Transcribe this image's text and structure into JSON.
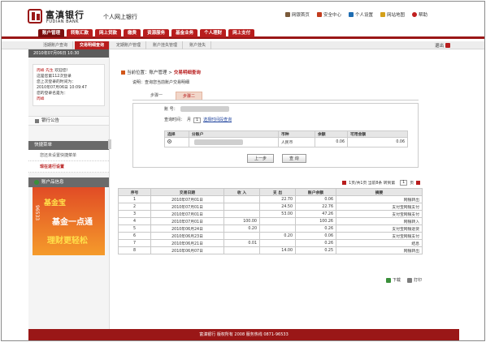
{
  "header": {
    "logo_cn": "富滇银行",
    "logo_en": "FUDIAN BANK",
    "subtitle": "个人网上银行",
    "links": [
      {
        "label": "网银首页",
        "icon": "home-icon",
        "color": "#7a5a3a"
      },
      {
        "label": "安全中心",
        "icon": "shield-icon",
        "color": "#c23c1e"
      },
      {
        "label": "个人设置",
        "icon": "user-icon",
        "color": "#1f6db2"
      },
      {
        "label": "网站地图",
        "icon": "sitemap-icon",
        "color": "#d4a019"
      },
      {
        "label": "帮助",
        "icon": "help-icon",
        "color": "#c01f1f"
      }
    ]
  },
  "nav": {
    "tabs": [
      "账户管理",
      "转账汇款",
      "网上贷款",
      "缴费",
      "资源服务",
      "基金业务",
      "个人理财",
      "网上支付"
    ],
    "active_index": 0
  },
  "subnav": {
    "items": [
      "活期账户查询",
      "交易明细查询",
      "定期账户管理",
      "账户挂失管理",
      "账户挂失"
    ],
    "active_index": 1,
    "logout": "退出"
  },
  "sidebar": {
    "date": "2010年07月06日 10:30",
    "welcome_name": "周峰 先生",
    "welcome_greeting": "欢迎您！",
    "welcome_text": [
      "这是您第112次登录",
      "您上次登录的时间为：",
      "2010年07月06日 10:09:47",
      "您的登录名是为：",
      "周峰"
    ],
    "notice": "银行公告",
    "quick_menu": "快捷菜单",
    "quick_links": [
      "您还未设置快捷菜单",
      "现在进行设置"
    ],
    "promo_head": "账户品信息",
    "promo": {
      "line1": "基金宝",
      "line2": "基金一点通",
      "line3": "理财更轻松",
      "phone": "96533"
    }
  },
  "content": {
    "crumb_prefix": "当前位置：账户管理 >",
    "crumb_current": "交易明细查询",
    "note": "说明：查询您当前账户交易明细",
    "steps": [
      "步骤一",
      "步骤二"
    ],
    "step_active": 1,
    "account_label": "账    号：",
    "period_label": "查询时间：",
    "period_select": "月",
    "period_value": "1",
    "period_link": "选择时间段查询",
    "acct_headers": [
      "选择",
      "分账户",
      "币种",
      "余额",
      "可用金额"
    ],
    "acct_row": {
      "currency": "人民币",
      "balance": "0.06",
      "available": "0.06"
    },
    "btn_prev": "上一步",
    "btn_query": "查 询",
    "pager": "1页/共1页  当前8条  转到第",
    "pager_unit": "页",
    "txn_headers": [
      "序号",
      "交易日期",
      "收 入",
      "支 出",
      "账户余额",
      "摘要"
    ],
    "txn_rows": [
      {
        "no": "1",
        "date": "2010年07月01日",
        "income": "",
        "expense": "22.70",
        "balance": "0.06",
        "memo": "网银转出"
      },
      {
        "no": "2",
        "date": "2010年07月01日",
        "income": "",
        "expense": "24.50",
        "balance": "22.76",
        "memo": "支付宝网银支付"
      },
      {
        "no": "3",
        "date": "2010年07月01日",
        "income": "",
        "expense": "53.00",
        "balance": "47.26",
        "memo": "支付宝网银支付"
      },
      {
        "no": "4",
        "date": "2010年07月01日",
        "income": "100.00",
        "expense": "",
        "balance": "100.26",
        "memo": "网银转入"
      },
      {
        "no": "5",
        "date": "2010年06月24日",
        "income": "0.20",
        "expense": "",
        "balance": "0.26",
        "memo": "支付宝网银退货"
      },
      {
        "no": "6",
        "date": "2010年06月23日",
        "income": "",
        "expense": "0.20",
        "balance": "0.06",
        "memo": "支付宝网银支付"
      },
      {
        "no": "7",
        "date": "2010年06月21日",
        "income": "0.01",
        "expense": "",
        "balance": "0.26",
        "memo": "结息"
      },
      {
        "no": "8",
        "date": "2010年06月07日",
        "income": "",
        "expense": "14.00",
        "balance": "0.25",
        "memo": "网银转出"
      }
    ],
    "download": "下载",
    "print": "打印"
  },
  "footer": {
    "text": "富滇银行  版权所有 2008  服务热线 0871-96533"
  }
}
